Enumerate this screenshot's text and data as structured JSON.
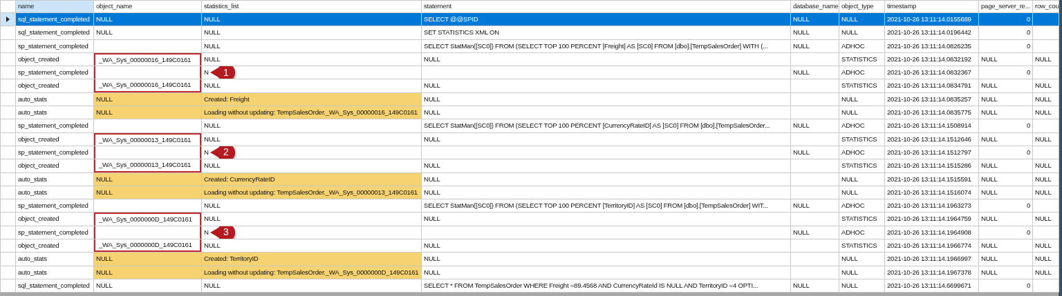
{
  "columns": [
    {
      "label": "name",
      "selected": true
    },
    {
      "label": "object_name",
      "selected": false
    },
    {
      "label": "statistics_list",
      "selected": false
    },
    {
      "label": "statement",
      "selected": false
    },
    {
      "label": "database_name",
      "selected": false
    },
    {
      "label": "object_type",
      "selected": false
    },
    {
      "label": "timestamp",
      "selected": false
    },
    {
      "label": "page_server_re...",
      "selected": false
    },
    {
      "label": "row_cou",
      "selected": false
    }
  ],
  "rows": [
    {
      "selected": true,
      "highlight": false,
      "boxed": false,
      "cells": [
        "sql_statement_completed",
        "NULL",
        "NULL",
        "SELECT @@SPID",
        "NULL",
        "NULL",
        "2021-10-26 13:11:14.0155689",
        {
          "text": "0",
          "numeric": true
        },
        null
      ]
    },
    {
      "selected": false,
      "highlight": false,
      "boxed": false,
      "cells": [
        "sql_statement_completed",
        "NULL",
        "NULL",
        "SET STATISTICS XML ON",
        "NULL",
        "NULL",
        "2021-10-26 13:11:14.0196442",
        {
          "text": "0",
          "numeric": true
        },
        null
      ]
    },
    {
      "selected": false,
      "highlight": false,
      "boxed": false,
      "cells": [
        "sp_statement_completed",
        null,
        "NULL",
        "SELECT StatMan([SC0]) FROM (SELECT TOP 100 PERCENT [Freight] AS [SC0] FROM [dbo].[TempSalesOrder] WITH (...",
        "NULL",
        "ADHOC",
        "2021-10-26 13:11:14.0826235",
        {
          "text": "0",
          "numeric": true
        },
        null
      ]
    },
    {
      "selected": false,
      "highlight": false,
      "boxed": true,
      "cells": [
        "object_created",
        "_WA_Sys_00000016_149C0161",
        "NULL",
        "NULL",
        null,
        "STATISTICS",
        "2021-10-26 13:11:14.0832192",
        "NULL",
        "NULL"
      ]
    },
    {
      "selected": false,
      "highlight": false,
      "boxed": true,
      "callout": "1",
      "cells": [
        "sp_statement_completed",
        null,
        "N",
        null,
        "NULL",
        "ADHOC",
        "2021-10-26 13:11:14.0832367",
        {
          "text": "0",
          "numeric": true
        },
        null
      ]
    },
    {
      "selected": false,
      "highlight": false,
      "boxed": true,
      "cells": [
        "object_created",
        "_WA_Sys_00000016_149C0161",
        "NULL",
        "NULL",
        null,
        "STATISTICS",
        "2021-10-26 13:11:14.0834791",
        "NULL",
        "NULL"
      ]
    },
    {
      "selected": false,
      "highlight": true,
      "boxed": false,
      "cells": [
        "auto_stats",
        "NULL",
        "Created: Freight",
        "NULL",
        null,
        "NULL",
        "2021-10-26 13:11:14.0835257",
        "NULL",
        "NULL"
      ]
    },
    {
      "selected": false,
      "highlight": true,
      "boxed": false,
      "cells": [
        "auto_stats",
        "NULL",
        "Loading without updating: TempSalesOrder._WA_Sys_00000016_149C0161",
        "NULL",
        null,
        "NULL",
        "2021-10-26 13:11:14.0835775",
        "NULL",
        "NULL"
      ]
    },
    {
      "selected": false,
      "highlight": false,
      "boxed": false,
      "cells": [
        "sp_statement_completed",
        null,
        "NULL",
        "SELECT StatMan([SC0]) FROM (SELECT TOP 100 PERCENT [CurrencyRateID] AS [SC0] FROM [dbo].[TempSalesOrder...",
        "NULL",
        "ADHOC",
        "2021-10-26 13:11:14.1508914",
        {
          "text": "0",
          "numeric": true
        },
        null
      ]
    },
    {
      "selected": false,
      "highlight": false,
      "boxed": true,
      "cells": [
        "object_created",
        "_WA_Sys_00000013_149C0161",
        "NULL",
        "NULL",
        null,
        "STATISTICS",
        "2021-10-26 13:11:14.1512646",
        "NULL",
        "NULL"
      ]
    },
    {
      "selected": false,
      "highlight": false,
      "boxed": true,
      "callout": "2",
      "cells": [
        "sp_statement_completed",
        null,
        "N",
        null,
        "NULL",
        "ADHOC",
        "2021-10-26 13:11:14.1512797",
        {
          "text": "0",
          "numeric": true
        },
        null
      ]
    },
    {
      "selected": false,
      "highlight": false,
      "boxed": true,
      "cells": [
        "object_created",
        "_WA_Sys_00000013_149C0161",
        "NULL",
        "NULL",
        null,
        "STATISTICS",
        "2021-10-26 13:11:14.1515286",
        "NULL",
        "NULL"
      ]
    },
    {
      "selected": false,
      "highlight": true,
      "boxed": false,
      "cells": [
        "auto_stats",
        "NULL",
        "Created: CurrencyRateID",
        "NULL",
        null,
        "NULL",
        "2021-10-26 13:11:14.1515591",
        "NULL",
        "NULL"
      ]
    },
    {
      "selected": false,
      "highlight": true,
      "boxed": false,
      "cells": [
        "auto_stats",
        "NULL",
        "Loading without updating: TempSalesOrder._WA_Sys_00000013_149C0161",
        "NULL",
        null,
        "NULL",
        "2021-10-26 13:11:14.1516074",
        "NULL",
        "NULL"
      ]
    },
    {
      "selected": false,
      "highlight": false,
      "boxed": false,
      "cells": [
        "sp_statement_completed",
        null,
        "NULL",
        "SELECT StatMan([SC0]) FROM (SELECT TOP 100 PERCENT [TerritoryID] AS [SC0] FROM [dbo].[TempSalesOrder] WIT...",
        "NULL",
        "ADHOC",
        "2021-10-26 13:11:14.1963273",
        {
          "text": "0",
          "numeric": true
        },
        null
      ]
    },
    {
      "selected": false,
      "highlight": false,
      "boxed": true,
      "cells": [
        "object_created",
        "_WA_Sys_0000000D_149C0161",
        "NULL",
        "NULL",
        null,
        "STATISTICS",
        "2021-10-26 13:11:14.1964759",
        "NULL",
        "NULL"
      ]
    },
    {
      "selected": false,
      "highlight": false,
      "boxed": true,
      "callout": "3",
      "cells": [
        "sp_statement_completed",
        null,
        "N",
        null,
        "NULL",
        "ADHOC",
        "2021-10-26 13:11:14.1964908",
        {
          "text": "0",
          "numeric": true
        },
        null
      ]
    },
    {
      "selected": false,
      "highlight": false,
      "boxed": true,
      "cells": [
        "object_created",
        "_WA_Sys_0000000D_149C0161",
        "NULL",
        "NULL",
        null,
        "STATISTICS",
        "2021-10-26 13:11:14.1966774",
        "NULL",
        "NULL"
      ]
    },
    {
      "selected": false,
      "highlight": true,
      "boxed": false,
      "cells": [
        "auto_stats",
        "NULL",
        "Created: TerritoryID",
        "NULL",
        null,
        "NULL",
        "2021-10-26 13:11:14.1966997",
        "NULL",
        "NULL"
      ]
    },
    {
      "selected": false,
      "highlight": true,
      "boxed": false,
      "cells": [
        "auto_stats",
        "NULL",
        "Loading without updating: TempSalesOrder._WA_Sys_0000000D_149C0161",
        "NULL",
        null,
        "NULL",
        "2021-10-26 13:11:14.1967378",
        "NULL",
        "NULL"
      ]
    },
    {
      "selected": false,
      "highlight": false,
      "boxed": false,
      "cells": [
        "sql_statement_completed",
        "NULL",
        "NULL",
        "SELECT * FROM TempSalesOrder WHERE Freight =89.4568   AND CurrencyRateId IS NULL AND TerritoryID =4  OPTI...",
        "NULL",
        "NULL",
        "2021-10-26 13:11:14.6699671",
        {
          "text": "0",
          "numeric": true
        },
        null
      ]
    }
  ]
}
